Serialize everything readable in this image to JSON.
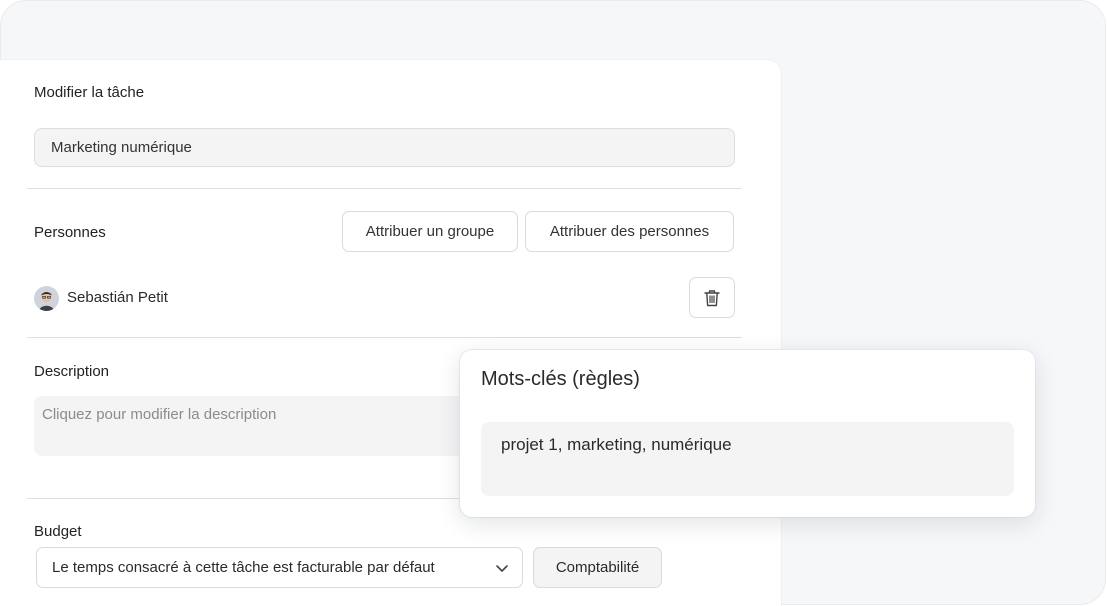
{
  "task": {
    "section_label": "Modifier la tâche",
    "name_value": "Marketing numérique"
  },
  "people": {
    "section_label": "Personnes",
    "assign_group_label": "Attribuer un groupe",
    "assign_people_label": "Attribuer des personnes",
    "assigned": [
      {
        "name": "Sebastián Petit"
      }
    ]
  },
  "description": {
    "section_label": "Description",
    "placeholder": "Cliquez pour modifier la description"
  },
  "budget": {
    "section_label": "Budget",
    "billing_selected": "Le temps consacré à cette tâche est facturable par défaut",
    "accounting_label": "Comptabilité"
  },
  "keywords_popup": {
    "title": "Mots-clés (règles)",
    "value": "projet 1, marketing, numérique"
  },
  "icons": {
    "trash": "trash-icon",
    "chevron": "chevron-down-icon",
    "avatar": "avatar"
  }
}
